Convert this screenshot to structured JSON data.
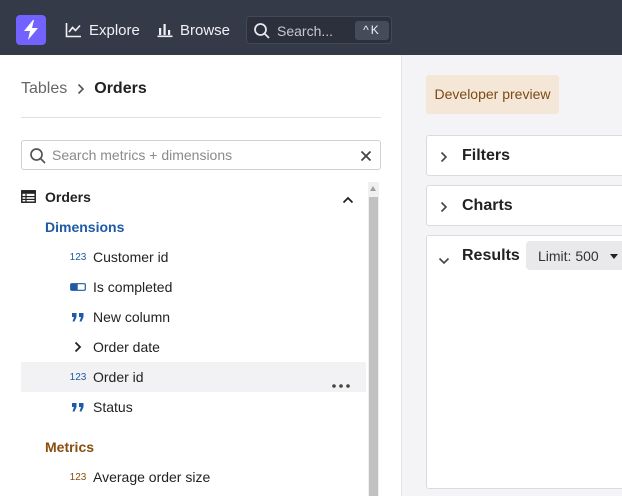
{
  "topbar": {
    "nav": [
      {
        "label": "Explore",
        "icon": "explore-chart-icon"
      },
      {
        "label": "Browse",
        "icon": "bar-chart-icon"
      }
    ],
    "search": {
      "placeholder": "Search...",
      "shortcut": "^K"
    }
  },
  "sidebar": {
    "breadcrumb": [
      "Tables",
      "Orders"
    ],
    "search_placeholder": "Search metrics + dimensions",
    "table": {
      "name": "Orders",
      "expanded": true
    },
    "dimensions_label": "Dimensions",
    "dimensions": [
      {
        "label": "Customer id",
        "type": "number",
        "type_text": "123"
      },
      {
        "label": "Is completed",
        "type": "boolean"
      },
      {
        "label": "New column",
        "type": "string"
      },
      {
        "label": "Order date",
        "type": "date-group"
      },
      {
        "label": "Order id",
        "type": "number",
        "type_text": "123",
        "highlighted": true
      },
      {
        "label": "Status",
        "type": "string"
      }
    ],
    "metrics_label": "Metrics",
    "metrics": [
      {
        "label": "Average order size",
        "type": "number",
        "type_text": "123"
      }
    ]
  },
  "main": {
    "badge": "Developer preview",
    "sections": [
      {
        "label": "Filters",
        "expanded": false
      },
      {
        "label": "Charts",
        "expanded": false
      },
      {
        "label": "Results",
        "expanded": true
      }
    ],
    "limit_label": "Limit: 500"
  },
  "colors": {
    "topbar": "#343a48",
    "brand": "#7262ff",
    "dimension": "#1f5aa6",
    "metric": "#8a4d0f",
    "badge_bg": "#f5e7d8"
  }
}
